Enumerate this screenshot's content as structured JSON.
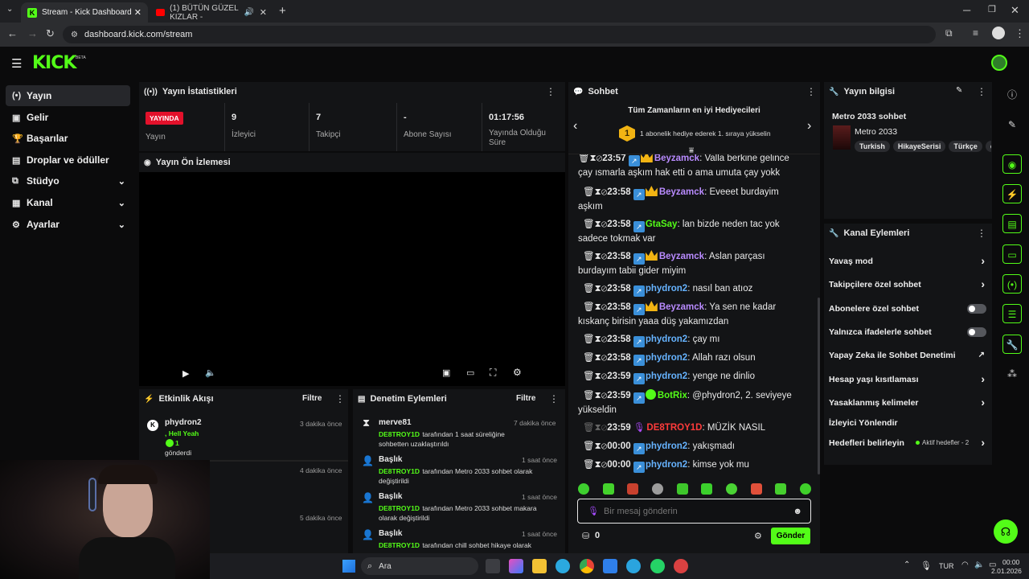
{
  "browser": {
    "tabs": [
      {
        "title": "Stream - Kick Dashboard"
      },
      {
        "title": "(1) BÜTÜN GÜZEL KIZLAR -"
      }
    ],
    "url": "dashboard.kick.com/stream"
  },
  "kick": {
    "logo": "KICK",
    "logo_tag": "BETA"
  },
  "sidebar": {
    "items": [
      {
        "label": "Yayın"
      },
      {
        "label": "Gelir"
      },
      {
        "label": "Başarılar"
      },
      {
        "label": "Droplar ve ödüller"
      },
      {
        "label": "Stüdyo"
      },
      {
        "label": "Kanal"
      },
      {
        "label": "Ayarlar"
      }
    ]
  },
  "stats": {
    "title": "Yayın İstatistikleri",
    "live_badge": "YAYINDA",
    "live_label": "Yayın",
    "viewers": "9",
    "viewers_label": "İzleyici",
    "followers": "7",
    "followers_label": "Takipçi",
    "subs": "-",
    "subs_label": "Abone Sayısı",
    "uptime": "01:17:56",
    "uptime_label": "Yayında Olduğu Süre"
  },
  "preview": {
    "title": "Yayın Ön İzlemesi"
  },
  "activity": {
    "title": "Etkinlik Akışı",
    "filter": "Filtre",
    "items": [
      {
        "user": "phydron2",
        "text": ", Hell Yeah",
        "count": "1",
        "action": "gönderdi",
        "time": "3 dakika önce"
      },
      {
        "time": "4 dakika önce"
      },
      {
        "time": "5 dakika önce"
      }
    ]
  },
  "moderation": {
    "title": "Denetim Eylemleri",
    "filter": "Filtre",
    "items": [
      {
        "title": "merve81",
        "actor": "DE8TROY1D",
        "text": "tarafından 1 saat süreliğine sohbetten uzaklaştırıldı",
        "time": "7 dakika önce"
      },
      {
        "title": "Başlık",
        "actor": "DE8TROY1D",
        "text": "tarafından Metro 2033 sohbet olarak değiştirildi",
        "time": "1 saat önce"
      },
      {
        "title": "Başlık",
        "actor": "DE8TROY1D",
        "text": "tarafından Metro 2033 sohbet makara olarak değiştirildi",
        "time": "1 saat önce"
      },
      {
        "title": "Başlık",
        "actor": "DE8TROY1D",
        "text": "tarafından chill sohbet hikaye olarak",
        "time": "1 saat önce"
      }
    ]
  },
  "chat": {
    "title": "Sohbet",
    "gifters_title": "Tüm Zamanların en iyi Hediyecileri",
    "gifters_rank": "1",
    "gifters_text": "1 abonelik hediye ederek 1. sıraya yükselin",
    "messages": [
      {
        "time": "23:57",
        "user": "Beyzamck",
        "text": "Valla berkine gelince çay ısmarla aşkım hak etti o ama umuta çay yokk"
      },
      {
        "time": "23:58",
        "user": "Beyzamck",
        "text": "Eveeet burdayim aşkım"
      },
      {
        "time": "23:58",
        "user": "GtaSay",
        "text": "lan bizde neden tac yok sadece tokmak var"
      },
      {
        "time": "23:58",
        "user": "Beyzamck",
        "text": "Aslan parçası burdayım tabii gider miyim"
      },
      {
        "time": "23:58",
        "user": "phydron2",
        "text": "nasıl ban atıoz"
      },
      {
        "time": "23:58",
        "user": "Beyzamck",
        "text": "Ya sen ne kadar kıskanç birisin yaaa düş yakamızdan"
      },
      {
        "time": "23:58",
        "user": "phydron2",
        "text": "çay mı"
      },
      {
        "time": "23:58",
        "user": "phydron2",
        "text": "Allah razı olsun"
      },
      {
        "time": "23:59",
        "user": "phydron2",
        "text": "yenge ne dinlio"
      },
      {
        "time": "23:59",
        "user": "BotRix",
        "text": "@phydron2, 2. seviyeye yükseldin"
      },
      {
        "time": "23:59",
        "user": "DE8TROY1D",
        "text": "MÜZİK NASIL"
      },
      {
        "time": "00:00",
        "user": "phydron2",
        "text": "yakışmadı"
      },
      {
        "time": "00:00",
        "user": "phydron2",
        "text": "kimse yok mu"
      }
    ],
    "input_placeholder": "Bir mesaj gönderin",
    "points": "0",
    "send": "Gönder"
  },
  "stream_info": {
    "title": "Yayın bilgisi",
    "stream_title": "Metro 2033 sohbet",
    "category": "Metro 2033",
    "tags": [
      "Turkish",
      "HikayeSerisi",
      "Türkçe",
      "c"
    ]
  },
  "channel_actions": {
    "title": "Kanal Eylemleri",
    "items": [
      {
        "label": "Yavaş mod"
      },
      {
        "label": "Takipçilere özel sohbet"
      },
      {
        "label": "Abonelere özel sohbet"
      },
      {
        "label": "Yalnızca ifadelerle sohbet"
      },
      {
        "label": "Yapay Zeka ile Sohbet Denetimi"
      },
      {
        "label": "Hesap yaşı kısıtlaması"
      },
      {
        "label": "Yasaklanmış kelimeler"
      },
      {
        "label": "İzleyici Yönlendir"
      },
      {
        "label": "Hedefleri belirleyin"
      }
    ],
    "goals_status": "Aktif hedefler - 2"
  },
  "taskbar": {
    "search": "Ara",
    "lang": "TUR",
    "time": "00:00",
    "date": "2.01.2026"
  },
  "colors": {
    "brand": "#53fc18",
    "live": "#e3112b",
    "panel": "#131416"
  }
}
